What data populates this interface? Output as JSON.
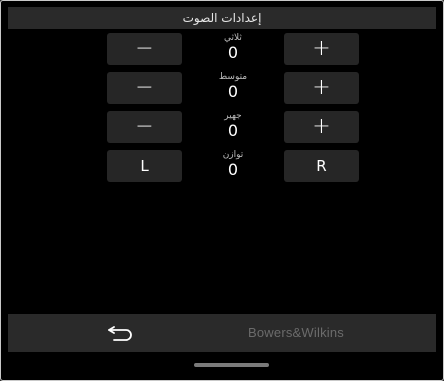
{
  "window": {
    "title": "إعدادات الصوت"
  },
  "controls": [
    {
      "label": "ثلاثي",
      "value": "0",
      "left_button": "−",
      "right_button": "+"
    },
    {
      "label": "متوسط",
      "value": "0",
      "left_button": "−",
      "right_button": "+"
    },
    {
      "label": "جهير",
      "value": "0",
      "left_button": "−",
      "right_button": "+"
    },
    {
      "label": "توازن",
      "value": "0",
      "left_button": "L",
      "right_button": "R"
    }
  ],
  "footer": {
    "brand": "Bowers&Wilkins",
    "back_icon": "back-arrow-icon"
  },
  "colors": {
    "background": "#000000",
    "bar": "#2a2a2a",
    "button": "#262626",
    "brand_text": "#6b6b6b"
  }
}
